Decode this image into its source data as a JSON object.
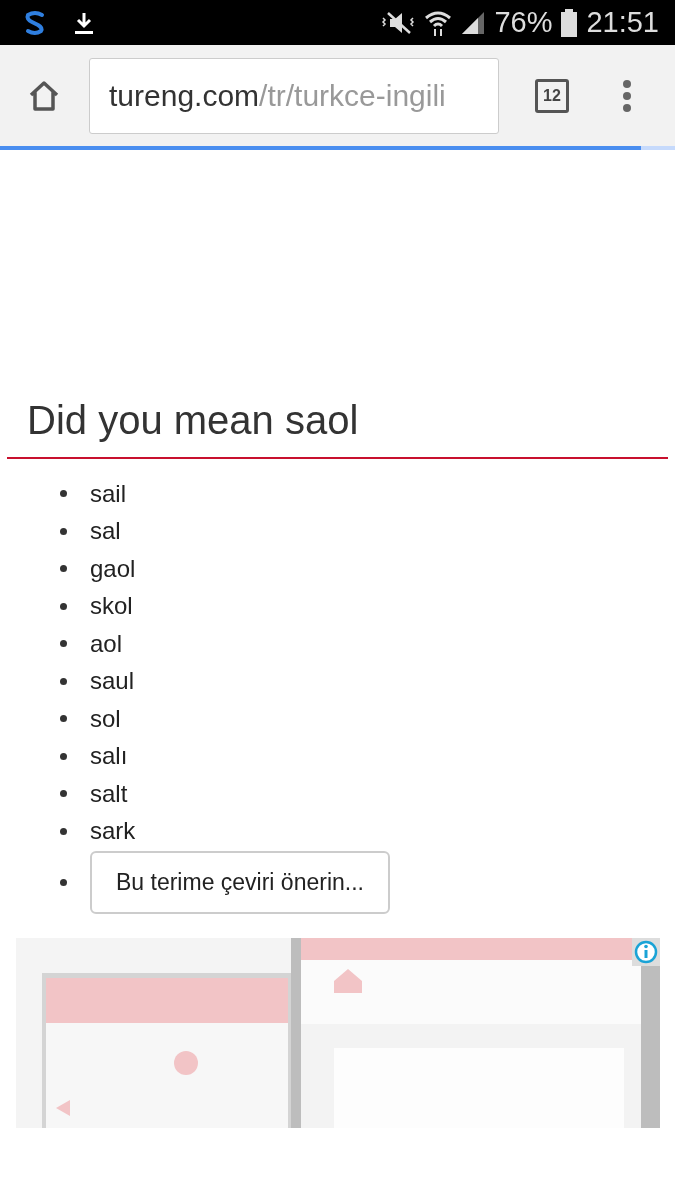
{
  "status_bar": {
    "battery": "76%",
    "time": "21:51"
  },
  "browser": {
    "url_host": "tureng.com",
    "url_path": "/tr/turkce-ingili",
    "tab_count": "12",
    "load_progress": {
      "level": 0.95
    }
  },
  "page": {
    "heading": "Did you mean saol",
    "suggestions": [
      "sail",
      "sal",
      "gaol",
      "skol",
      "aol",
      "saul",
      "sol",
      "salı",
      "salt",
      "sark"
    ],
    "suggest_button": "Bu terime çeviri önerin..."
  }
}
